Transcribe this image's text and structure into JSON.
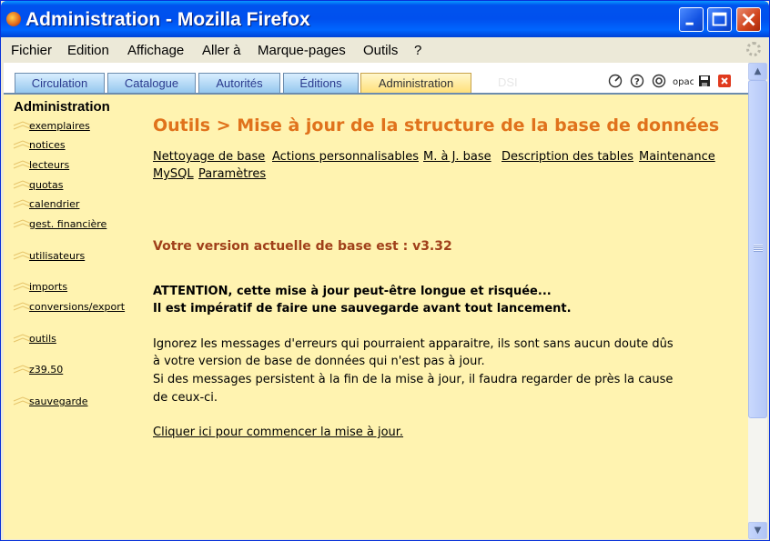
{
  "window": {
    "title": "Administration - Mozilla Firefox"
  },
  "menubar": {
    "items": [
      "Fichier",
      "Edition",
      "Affichage",
      "Aller à",
      "Marque-pages",
      "Outils",
      "?"
    ]
  },
  "tabs": {
    "items": [
      "Circulation",
      "Catalogue",
      "Autorités",
      "Éditions",
      "Administration"
    ],
    "active": "Administration",
    "ghost": "DSI"
  },
  "toolbar_icons": [
    "refresh-icon",
    "help-icon",
    "settings-icon",
    "opac-icon",
    "save-icon",
    "close-icon"
  ],
  "toolbar": {
    "opac_label": "opac"
  },
  "sidebar": {
    "title": "Administration",
    "items": [
      "exemplaires",
      "notices",
      "lecteurs",
      "quotas",
      "calendrier",
      "gest. financière",
      "utilisateurs",
      "imports",
      "conversions/export",
      "outils",
      "z39.50",
      "sauvegarde"
    ]
  },
  "main": {
    "heading": "Outils > Mise à jour de la structure de la base de données",
    "links": [
      "Nettoyage de base",
      "Actions personnalisables",
      "M. à J. base",
      "Description des tables",
      "Maintenance MySQL",
      "Paramètres"
    ],
    "version": "Votre version actuelle de base est : v3.32",
    "warning_line1": "ATTENTION, cette mise à jour peut-être longue et risquée...",
    "warning_line2": "Il est impératif de faire une sauvegarde avant tout lancement.",
    "info_lines": [
      "Ignorez les messages d'erreurs qui pourraient apparaitre, ils sont sans aucun doute dûs",
      "à votre version de base de données qui n'est pas à jour.",
      "Si des messages persistent à la fin de la mise à jour, il faudra regarder de près la cause",
      "de ceux-ci."
    ],
    "start_link": "Cliquer ici pour commencer la mise à jour."
  },
  "colors": {
    "content_bg": "#fff3b0",
    "heading": "#e0721c",
    "version": "#a0401a",
    "titlebar": "#0053ee",
    "tab_inactive": "#95c7ee",
    "tab_active": "#ffe07a"
  }
}
